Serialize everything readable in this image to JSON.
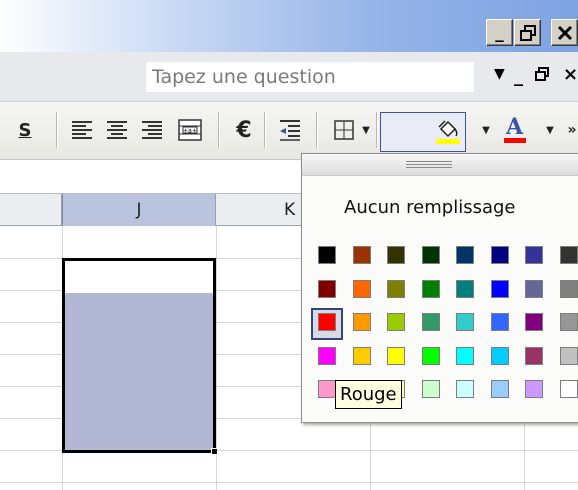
{
  "window": {
    "minimize": "_",
    "restore": "🗗",
    "close": "✕"
  },
  "menu": {
    "question_placeholder": "Tapez une question",
    "dropdown": "▼",
    "doc_minimize": "_",
    "doc_restore": "🗗",
    "doc_close": "×"
  },
  "toolbar": {
    "shadow_label": "S",
    "euro_label": "€",
    "font_color_label": "A",
    "colors": {
      "fill_underline": "#ffff00",
      "font_underline": "#ff0000",
      "accent": "#3a54a7"
    }
  },
  "sheet": {
    "columns": [
      {
        "label": "J",
        "selected": true
      },
      {
        "label": "K",
        "selected": false
      }
    ],
    "selection_fill_color": "#b2b8d3"
  },
  "palette": {
    "no_fill_label": "Aucun remplissage",
    "tooltip": "Rouge",
    "rows": [
      [
        "#000000",
        "#993300",
        "#333300",
        "#003300",
        "#003366",
        "#000080",
        "#333399",
        "#333333"
      ],
      [
        "#800000",
        "#ff6600",
        "#808000",
        "#008000",
        "#008080",
        "#0000ff",
        "#666699",
        "#808080"
      ],
      [
        "#ff0000",
        "#ff9900",
        "#99cc00",
        "#339966",
        "#33cccc",
        "#3366ff",
        "#800080",
        "#969696"
      ],
      [
        "#ff00ff",
        "#ffcc00",
        "#ffff00",
        "#00ff00",
        "#00ffff",
        "#00ccff",
        "#993366",
        "#c0c0c0"
      ],
      [
        "#ff99cc",
        "#ffcc99",
        "#ffff99",
        "#ccffcc",
        "#ccffff",
        "#99ccff",
        "#cc99ff",
        "#ffffff"
      ]
    ],
    "selected_color": "#ff0000"
  }
}
